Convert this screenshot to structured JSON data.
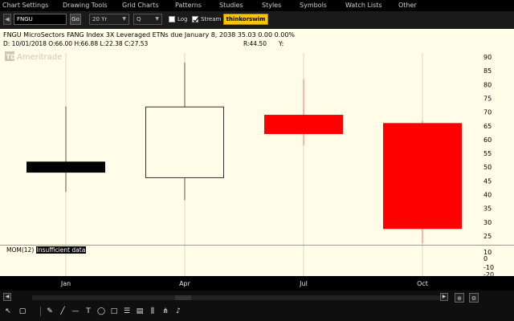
{
  "menu": [
    "Chart Settings",
    "Drawing Tools",
    "Grid Charts",
    "Patterns",
    "Studies",
    "Styles",
    "Symbols",
    "Watch Lists",
    "Other"
  ],
  "toolbar": {
    "symbol_value": "FNGU",
    "go_label": "Go",
    "timeframe_value": "20 Yr",
    "aggregation_value": "Q",
    "log_label": "Log",
    "log_checked": false,
    "stream_label": "Stream",
    "stream_checked": true,
    "thinkorswim_label": "thinkorswim"
  },
  "header": {
    "title": "FNGU MicroSectors FANG  Index 3X Leveraged ETNs due January 8, 2038  35.03  0.00  0.00%",
    "ohlc": "D:  10/01/2018 O:66.00 H:66.88 L:22.38 C:27.53",
    "r_value": "R:44.50",
    "y_label": "Y:",
    "watermark": "TD Ameritrade"
  },
  "chart_data": {
    "type": "candlestick",
    "y_ticks": [
      25,
      30,
      35,
      40,
      45,
      50,
      55,
      60,
      65,
      70,
      75,
      80,
      85,
      90
    ],
    "ylim": [
      22,
      91
    ],
    "categories": [
      "Jan",
      "Apr",
      "Jul",
      "Oct"
    ],
    "candles": [
      {
        "label": "Jan",
        "open": 52,
        "high": 72,
        "low": 41,
        "close": 48,
        "style": "filled",
        "color": "#000000"
      },
      {
        "label": "Apr",
        "open": 46,
        "high": 88,
        "low": 38,
        "close": 72,
        "style": "hollow",
        "color": "#000000"
      },
      {
        "label": "Jul",
        "open": 69,
        "high": 82,
        "low": 58,
        "close": 62,
        "style": "filled",
        "color": "#ff0000"
      },
      {
        "label": "Oct",
        "open": 66,
        "high": 66.88,
        "low": 22.38,
        "close": 27.53,
        "style": "filled",
        "color": "#ff0000"
      }
    ],
    "study": {
      "name": "MOM(12)",
      "status": "Insufficient data",
      "y_ticks": [
        10,
        0,
        -10,
        -20
      ]
    },
    "colors": {
      "background": "#fffde8",
      "grid": "#d8d6c8",
      "up": "#000000",
      "down": "#ff0000"
    }
  }
}
